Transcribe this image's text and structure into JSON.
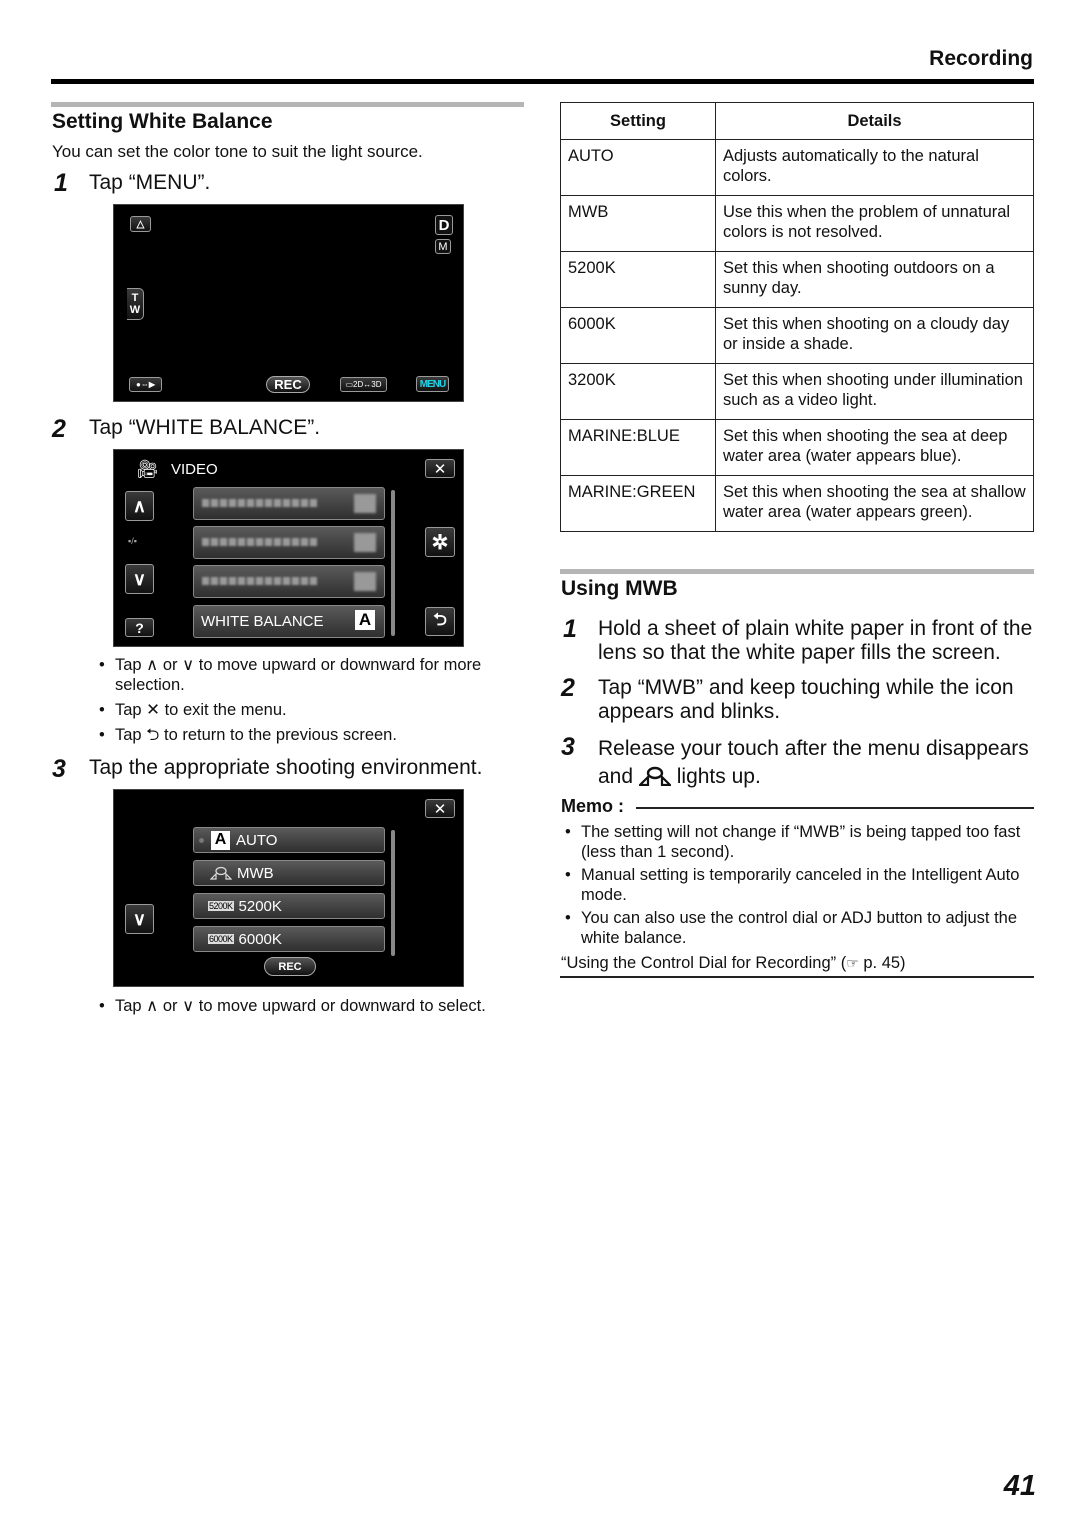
{
  "header": {
    "section": "Recording"
  },
  "left": {
    "title": "Setting White Balance",
    "intro": "You can set the color tone to suit the light source.",
    "steps": [
      {
        "num": "1",
        "text": "Tap “MENU”."
      },
      {
        "num": "2",
        "text": "Tap “WHITE BALANCE”."
      },
      {
        "num": "3",
        "text": "Tap the appropriate shooting environment."
      }
    ],
    "screen1": {
      "d_label": "D",
      "m_label": "M",
      "t_label": "T",
      "w_label": "W",
      "rec_label": "REC",
      "mode_label": "2D↔3D",
      "menu_label": "MENU",
      "menu_color": "#22d3e6"
    },
    "screen2": {
      "header": "VIDEO",
      "page_indicator": "▪/▪",
      "help_label": "?",
      "selected_item": "WHITE BALANCE",
      "selected_badge": "A"
    },
    "step2_bullets": [
      "Tap ∧ or ∨ to move upward or downward for more selection.",
      "Tap ✕ to exit the menu.",
      "Tap ⮌ to return to the previous screen."
    ],
    "screen3": {
      "options": [
        {
          "badge": "A",
          "label": "AUTO"
        },
        {
          "badge": "mwb",
          "label": "MWB"
        },
        {
          "badge": "5200K",
          "label": "5200K"
        },
        {
          "badge": "6000K",
          "label": "6000K"
        }
      ],
      "rec_label": "REC"
    },
    "step3_bullets": [
      "Tap ∧ or ∨ to move upward or downward to select."
    ]
  },
  "table": {
    "headers": [
      "Setting",
      "Details"
    ],
    "rows": [
      [
        "AUTO",
        "Adjusts automatically to the natural colors."
      ],
      [
        "MWB",
        "Use this when the problem of unnatural colors is not resolved."
      ],
      [
        "5200K",
        "Set this when shooting outdoors on a sunny day."
      ],
      [
        "6000K",
        "Set this when shooting on a cloudy day or inside a shade."
      ],
      [
        "3200K",
        "Set this when shooting under illumination such as a video light."
      ],
      [
        "MARINE:BLUE",
        "Set this when shooting the sea at deep water area (water appears blue)."
      ],
      [
        "MARINE:GREEN",
        "Set this when shooting the sea at shallow water area (water appears green)."
      ]
    ]
  },
  "mwb": {
    "title": "Using MWB",
    "steps": [
      {
        "num": "1",
        "text": "Hold a sheet of plain white paper in front of the lens so that the white paper fills the screen."
      },
      {
        "num": "2",
        "text": "Tap “MWB” and keep touching while the icon appears and blinks."
      },
      {
        "num": "3",
        "text_before": "Release your touch after the menu disappears and",
        "text_after": "lights up."
      }
    ]
  },
  "memo": {
    "title": "Memo :",
    "items": [
      "The setting will not change if “MWB” is being tapped too fast (less than 1 second).",
      "Manual setting is temporarily canceled in the Intelligent Auto mode.",
      "You can also use the control dial or ADJ button to adjust the white balance."
    ],
    "link_text": "“Using the Control Dial for Recording” (",
    "link_ref": "p. 45)"
  },
  "page_number": "41"
}
